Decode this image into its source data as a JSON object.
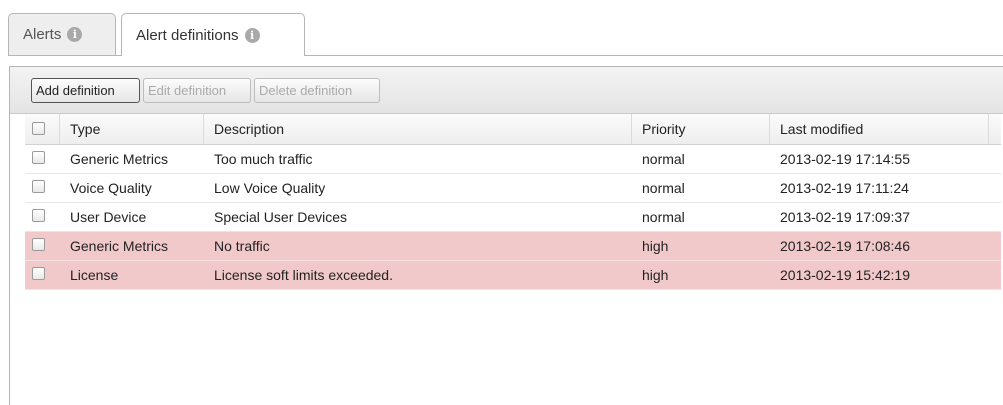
{
  "tabs": [
    {
      "label": "Alerts",
      "active": false
    },
    {
      "label": "Alert definitions",
      "active": true
    }
  ],
  "info_icon_glyph": "i",
  "toolbar": {
    "add_label": "Add definition",
    "edit_label": "Edit definition",
    "delete_label": "Delete definition"
  },
  "table": {
    "columns": [
      "Type",
      "Description",
      "Priority",
      "Last modified"
    ],
    "rows": [
      {
        "type": "Generic Metrics",
        "description": "Too much traffic",
        "priority": "normal",
        "modified": "2013-02-19 17:14:55",
        "highlighted": false
      },
      {
        "type": "Voice Quality",
        "description": "Low Voice Quality",
        "priority": "normal",
        "modified": "2013-02-19 17:11:24",
        "highlighted": false
      },
      {
        "type": "User Device",
        "description": "Special User Devices",
        "priority": "normal",
        "modified": "2013-02-19 17:09:37",
        "highlighted": false
      },
      {
        "type": "Generic Metrics",
        "description": "No traffic",
        "priority": "high",
        "modified": "2013-02-19 17:08:46",
        "highlighted": true
      },
      {
        "type": "License",
        "description": "License soft limits exceeded.",
        "priority": "high",
        "modified": "2013-02-19 15:42:19",
        "highlighted": true
      }
    ]
  },
  "colors": {
    "high_priority_row": "#f2c9cb",
    "info_icon": "#a9a9a9",
    "disabled_text": "#aaaaaa"
  }
}
